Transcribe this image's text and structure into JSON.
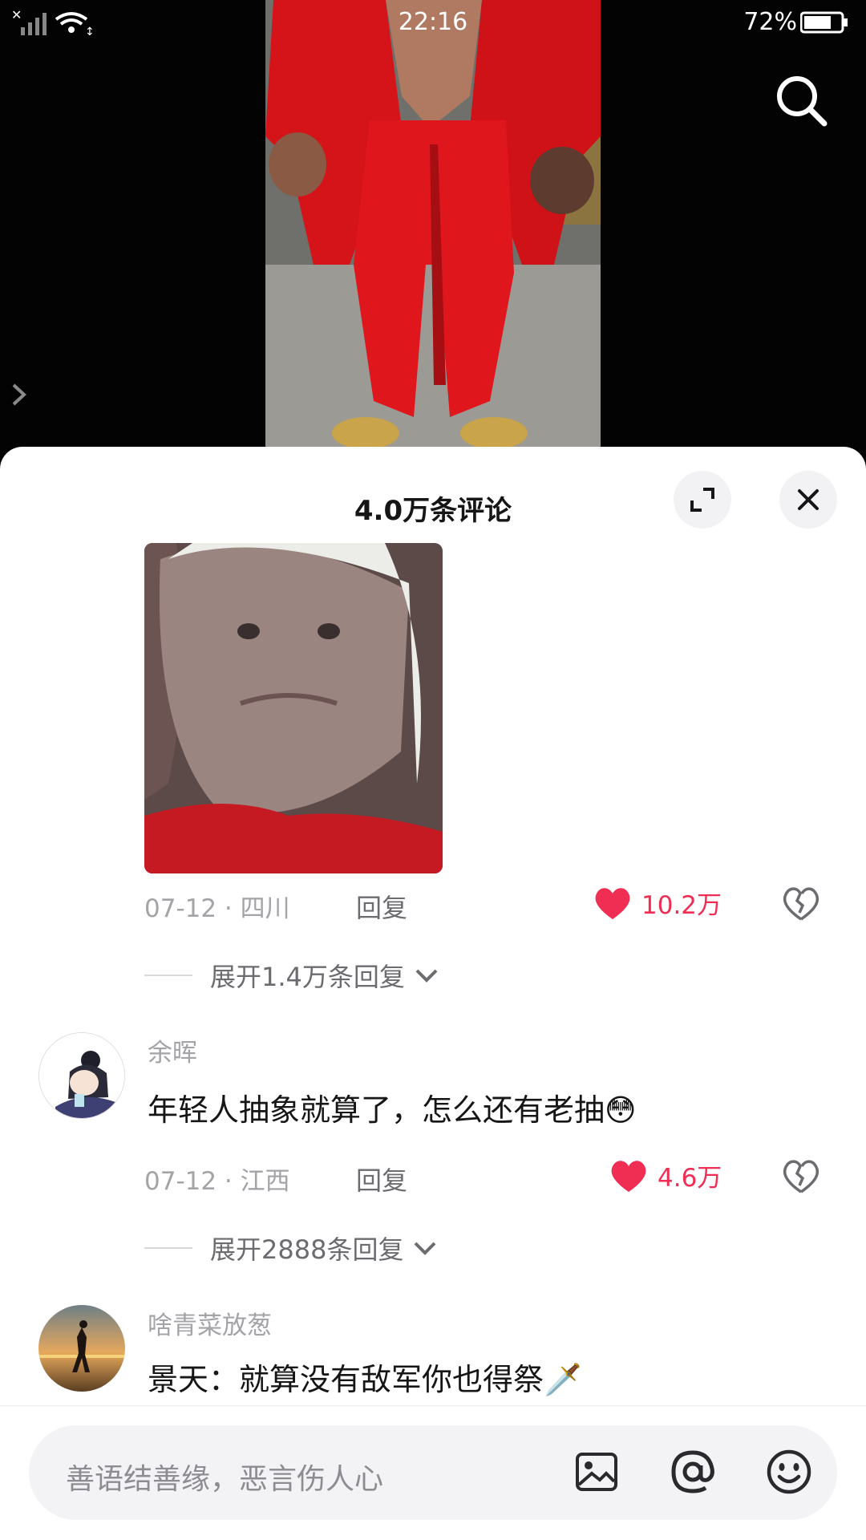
{
  "status_bar": {
    "time": "22:16",
    "battery": "72%"
  },
  "sheet": {
    "title": "4.0万条评论"
  },
  "comments": [
    {
      "meta": "07-12 · 四川",
      "reply_label": "回复",
      "likes": "10.2万",
      "expand_label": "展开1.4万条回复"
    },
    {
      "username": "余晖",
      "text": "年轻人抽象就算了，怎么还有老抽😳",
      "meta": "07-12 · 江西",
      "reply_label": "回复",
      "likes": "4.6万",
      "expand_label": "展开2888条回复"
    },
    {
      "username": "啥青菜放葱",
      "text": "景天：就算没有敌军你也得祭🗡️"
    }
  ],
  "input": {
    "placeholder": "善语结善缘，恶言伤人心"
  },
  "icons": {
    "search": "search-icon",
    "expand": "expand-icon",
    "close": "close-icon",
    "like": "heart-icon",
    "dislike": "broken-heart-icon",
    "image": "image-icon",
    "mention": "at-icon",
    "emoji": "emoji-icon"
  },
  "colors": {
    "like_red": "#f02e54",
    "sheet_bg": "#ffffff",
    "muted_text": "#a3a3a8"
  }
}
